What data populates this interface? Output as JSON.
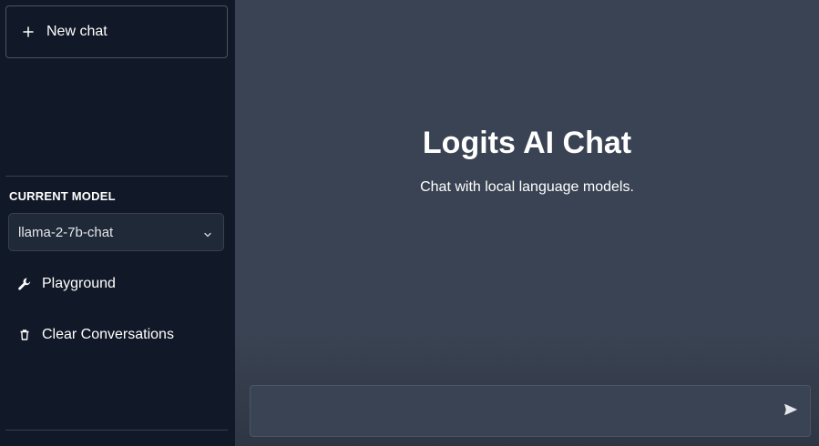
{
  "sidebar": {
    "new_chat_label": "New chat",
    "new_chat_icon": "plus-icon",
    "model_heading": "CURRENT MODEL",
    "model_selected": "llama-2-7b-chat",
    "items": [
      {
        "label": "Playground",
        "icon": "wrench-icon"
      },
      {
        "label": "Clear Conversations",
        "icon": "trash-icon"
      }
    ]
  },
  "main": {
    "title": "Logits AI Chat",
    "subtitle": "Chat with local language models.",
    "composer_placeholder": "",
    "send_icon": "send-icon"
  },
  "colors": {
    "sidebar_bg": "#111827",
    "main_bg": "#3a4353",
    "border": "#4b5563"
  }
}
